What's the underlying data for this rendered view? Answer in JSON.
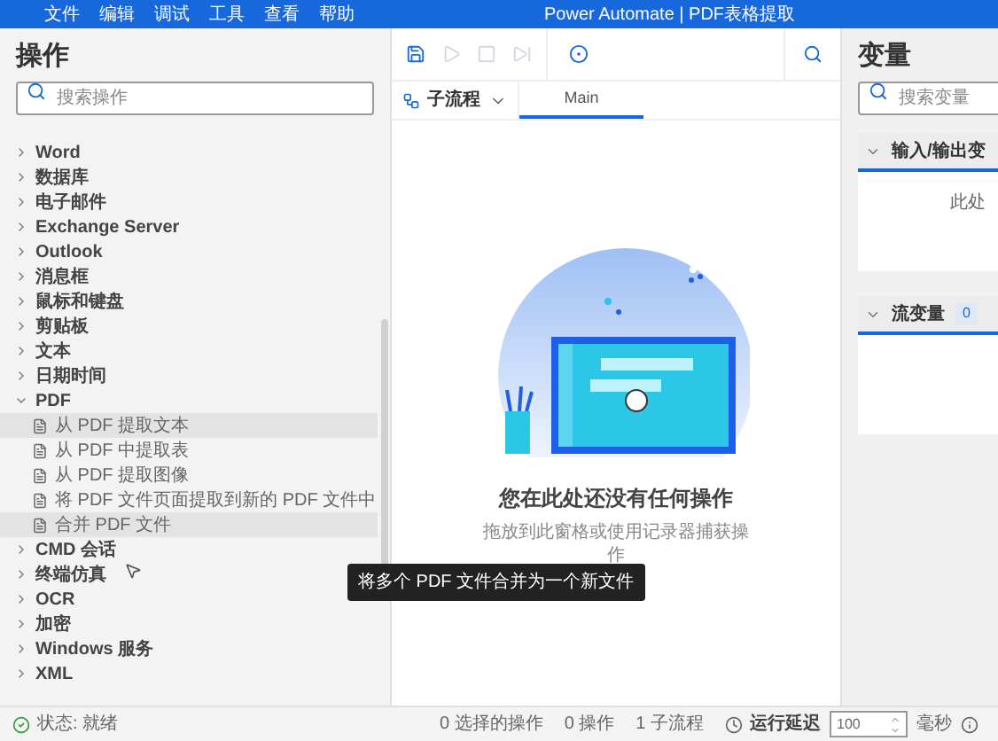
{
  "menu_bar": {
    "items": [
      "文件",
      "编辑",
      "调试",
      "工具",
      "查看",
      "帮助"
    ],
    "title": "Power Automate | PDF表格提取"
  },
  "actions_panel": {
    "title": "操作",
    "search": {
      "placeholder": "搜索操作"
    },
    "tree": [
      {
        "label": "Word",
        "expanded": false
      },
      {
        "label": "数据库",
        "expanded": false
      },
      {
        "label": "电子邮件",
        "expanded": false
      },
      {
        "label": "Exchange Server",
        "expanded": false
      },
      {
        "label": "Outlook",
        "expanded": false
      },
      {
        "label": "消息框",
        "expanded": false
      },
      {
        "label": "鼠标和键盘",
        "expanded": false
      },
      {
        "label": "剪贴板",
        "expanded": false
      },
      {
        "label": "文本",
        "expanded": false
      },
      {
        "label": "日期时间",
        "expanded": false
      },
      {
        "label": "PDF",
        "expanded": true,
        "children": [
          {
            "label": "从 PDF 提取文本",
            "highlighted": true
          },
          {
            "label": "从 PDF 中提取表",
            "highlighted": false
          },
          {
            "label": "从 PDF 提取图像",
            "highlighted": false
          },
          {
            "label": "将 PDF 文件页面提取到新的 PDF 文件中",
            "highlighted": false
          },
          {
            "label": "合并 PDF 文件",
            "highlighted": true
          }
        ]
      },
      {
        "label": "CMD 会话",
        "expanded": false
      },
      {
        "label": "终端仿真",
        "expanded": false
      },
      {
        "label": "OCR",
        "expanded": false
      },
      {
        "label": "加密",
        "expanded": false
      },
      {
        "label": "Windows 服务",
        "expanded": false
      },
      {
        "label": "XML",
        "expanded": false
      }
    ]
  },
  "tooltip": "将多个 PDF 文件合并为一个新文件",
  "designer": {
    "toolbar": [
      {
        "kind": "save",
        "disabled": false
      },
      {
        "kind": "run",
        "disabled": true
      },
      {
        "kind": "stop",
        "disabled": true
      },
      {
        "kind": "step",
        "disabled": true
      },
      {
        "kind": "record",
        "disabled": false
      }
    ],
    "subflows_label": "子流程",
    "tabs": [
      {
        "label": "Main",
        "selected": true
      }
    ],
    "empty_title": "您在此处还没有任何操作",
    "empty_description": "拖放到此窗格或使用记录器捕获操作"
  },
  "variables_panel": {
    "title": "变量",
    "search": {
      "placeholder": "搜索变量"
    },
    "sections": [
      {
        "title": "输入/输出变",
        "expanded": true,
        "body": "此处"
      },
      {
        "title": "流变量",
        "count": "0",
        "expanded": true
      }
    ]
  },
  "status_bar": {
    "status": "状态: 就绪",
    "selected_actions": "0 选择的操作",
    "actions": "0 操作",
    "subflows": "1 子流程",
    "delay_label": "运行延迟",
    "delay_value": "100",
    "delay_unit": "毫秒"
  }
}
